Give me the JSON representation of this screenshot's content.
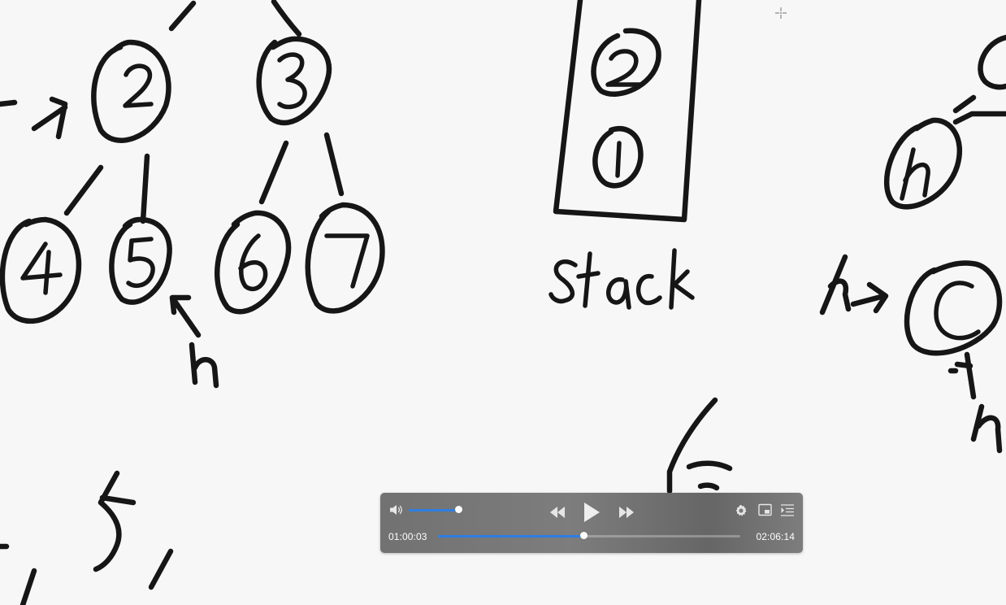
{
  "whiteboard": {
    "stack_label": "Stack",
    "tree_nodes": [
      "2",
      "3",
      "4",
      "5",
      "6",
      "7"
    ],
    "stack_items": [
      "2",
      "1"
    ]
  },
  "player": {
    "current_time": "01:00:03",
    "total_time": "02:06:14",
    "volume_level": 0.98,
    "progress": 0.48,
    "colors": {
      "accent": "#2f7de1",
      "bar": "#767676",
      "text": "#ffffff"
    },
    "icons": [
      "volume-icon",
      "rewind-icon",
      "play-icon",
      "fast-forward-icon",
      "settings-gear-icon",
      "picture-in-picture-icon",
      "playlist-icon"
    ]
  }
}
